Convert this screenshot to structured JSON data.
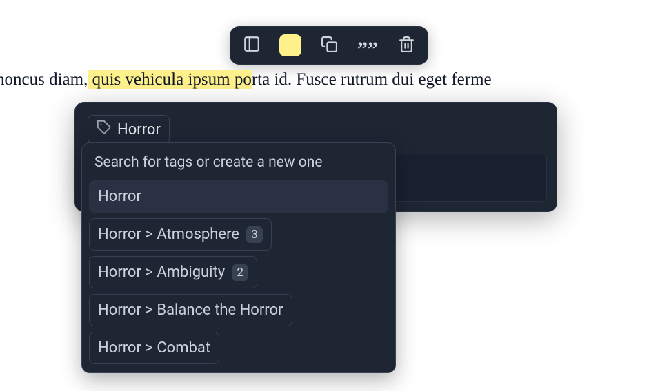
{
  "toolbar": {
    "highlight_color": "#fef08a"
  },
  "document": {
    "text_before": "m rhoncus diam,",
    "text_highlighted": " quis vehicula ipsum po",
    "text_after": "rta id. Fusce rutrum dui eget ferme"
  },
  "tag_panel": {
    "current_tag": "Horror"
  },
  "dropdown": {
    "header": "Search for tags or create a new one",
    "items": [
      {
        "label": "Horror",
        "count": null,
        "selected": true
      },
      {
        "label": "Horror > Atmosphere",
        "count": "3",
        "selected": false
      },
      {
        "label": "Horror > Ambiguity",
        "count": "2",
        "selected": false
      },
      {
        "label": "Horror > Balance the Horror",
        "count": null,
        "selected": false
      },
      {
        "label": "Horror > Combat",
        "count": null,
        "selected": false
      }
    ]
  }
}
